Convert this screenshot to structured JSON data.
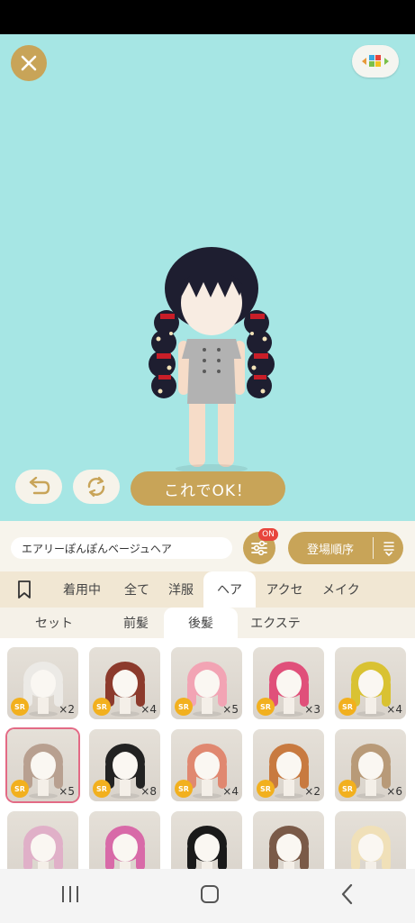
{
  "toolbar": {
    "ok_label": "これでOK！"
  },
  "name_bar": {
    "item_name": "エアリーぽんぽんベージュヘア",
    "filter_badge": "ON",
    "sort_label": "登場順序"
  },
  "tabs": [
    {
      "label": ""
    },
    {
      "label": "着用中"
    },
    {
      "label": "全て"
    },
    {
      "label": "洋服"
    },
    {
      "label": "ヘア"
    },
    {
      "label": "アクセ"
    },
    {
      "label": "メイク"
    }
  ],
  "subtabs": [
    {
      "label": "セット"
    },
    {
      "label": "前髪"
    },
    {
      "label": "後髪"
    },
    {
      "label": "エクステ"
    }
  ],
  "items": [
    {
      "rarity": "SR",
      "count": "×2",
      "hair": "#eceae6"
    },
    {
      "rarity": "SR",
      "count": "×4",
      "hair": "#8c3a2c"
    },
    {
      "rarity": "SR",
      "count": "×5",
      "hair": "#f2a4b4"
    },
    {
      "rarity": "SR",
      "count": "×3",
      "hair": "#e0507a"
    },
    {
      "rarity": "SR",
      "count": "×4",
      "hair": "#d9c232"
    },
    {
      "rarity": "SR",
      "count": "×5",
      "hair": "#b8a090"
    },
    {
      "rarity": "SR",
      "count": "×8",
      "hair": "#222222"
    },
    {
      "rarity": "SR",
      "count": "×4",
      "hair": "#e08870"
    },
    {
      "rarity": "SR",
      "count": "×2",
      "hair": "#c87a40"
    },
    {
      "rarity": "SR",
      "count": "×6",
      "hair": "#b89a78"
    },
    {
      "rarity": "",
      "count": "",
      "hair": "#e0b0c8"
    },
    {
      "rarity": "",
      "count": "",
      "hair": "#d86aa8"
    },
    {
      "rarity": "",
      "count": "",
      "hair": "#1a1a1a"
    },
    {
      "rarity": "",
      "count": "",
      "hair": "#7a5a48"
    },
    {
      "rarity": "",
      "count": "",
      "hair": "#f0e0b8"
    }
  ],
  "colors": {
    "stage": "#a6e6e4",
    "gold": "#c8a458",
    "badge": "#e8453c",
    "selected_outline": "#e36a85"
  }
}
